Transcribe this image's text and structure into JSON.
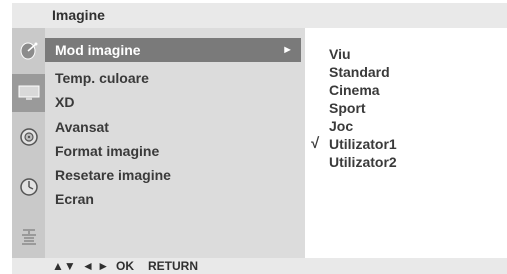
{
  "title": "Imagine",
  "icon_bar": {
    "icons": [
      "satellite-dish-icon",
      "tv-screen-icon",
      "speaker-icon",
      "clock-icon",
      "lock-icon"
    ],
    "active_index": 1
  },
  "menu": {
    "items": [
      {
        "label": "Mod imagine",
        "selected": true,
        "has_submenu": true
      },
      {
        "label": "Temp. culoare"
      },
      {
        "label": "XD"
      },
      {
        "label": "Avansat"
      },
      {
        "label": "Format imagine"
      },
      {
        "label": "Resetare imagine"
      },
      {
        "label": "Ecran"
      }
    ],
    "submenu_arrow": "►"
  },
  "options": {
    "items": [
      "Viu",
      "Standard",
      "Cinema",
      "Sport",
      "Joc",
      "Utilizator1",
      "Utilizator2"
    ],
    "checked_index": 5,
    "check_mark": "√"
  },
  "footer": {
    "nav_updown": "▲▼",
    "nav_leftright": "◄ ►",
    "ok_label": "OK",
    "return_label": "RETURN"
  },
  "colors": {
    "title_bar": "#e9e9e9",
    "icon_column": "#c9c9c9",
    "menu_panel": "#dcdcdc",
    "selected_bar": "#7a7a7a"
  }
}
